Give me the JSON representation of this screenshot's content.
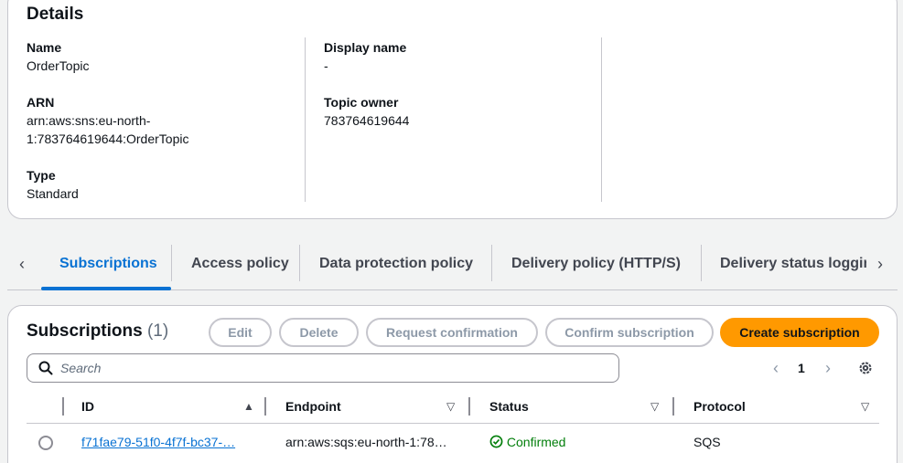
{
  "details": {
    "title": "Details",
    "name_label": "Name",
    "name_value": "OrderTopic",
    "arn_label": "ARN",
    "arn_value_line1": "arn:aws:sns:eu-north-",
    "arn_value_line2": "1:783764619644:OrderTopic",
    "type_label": "Type",
    "type_value": "Standard",
    "display_name_label": "Display name",
    "display_name_value": "-",
    "topic_owner_label": "Topic owner",
    "topic_owner_value": "783764619644"
  },
  "tabs": [
    {
      "label": "Subscriptions",
      "active": true
    },
    {
      "label": "Access policy"
    },
    {
      "label": "Data protection policy"
    },
    {
      "label": "Delivery policy (HTTP/S)"
    },
    {
      "label": "Delivery status logging"
    }
  ],
  "subscriptions": {
    "title": "Subscriptions",
    "count": "(1)",
    "buttons": {
      "edit": "Edit",
      "delete": "Delete",
      "request_confirmation": "Request confirmation",
      "confirm_subscription": "Confirm subscription",
      "create_subscription": "Create subscription"
    },
    "search_placeholder": "Search",
    "page": "1",
    "columns": [
      "ID",
      "Endpoint",
      "Status",
      "Protocol"
    ],
    "rows": [
      {
        "id": "f71fae79-51f0-4f7f-bc37-…",
        "endpoint": "arn:aws:sqs:eu-north-1:78…",
        "status": "Confirmed",
        "protocol": "SQS"
      }
    ]
  },
  "colors": {
    "accent": "#0972d3",
    "primary_button": "#ff9900",
    "success": "#037f0c"
  }
}
